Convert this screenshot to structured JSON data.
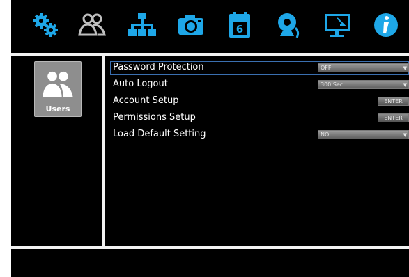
{
  "top_nav": {
    "icons": [
      "gears-icon",
      "users-icon",
      "network-icon",
      "camera-icon",
      "calendar-icon",
      "alarm-icon",
      "monitor-icon",
      "info-icon"
    ],
    "calendar_day": "6",
    "accent_color": "#1ea7e8"
  },
  "sidebar": {
    "selected_label": "Users",
    "tile_icon": "users-icon"
  },
  "settings": {
    "password_protection": {
      "label": "Password Protection",
      "value": "OFF"
    },
    "auto_logout": {
      "label": "Auto Logout",
      "value": "300 Sec"
    },
    "account_setup": {
      "label": "Account Setup",
      "button": "ENTER"
    },
    "permissions_setup": {
      "label": "Permissions Setup",
      "button": "ENTER"
    },
    "load_default": {
      "label": "Load Default Setting",
      "value": "NO"
    }
  },
  "dropdown_arrow": "▼"
}
